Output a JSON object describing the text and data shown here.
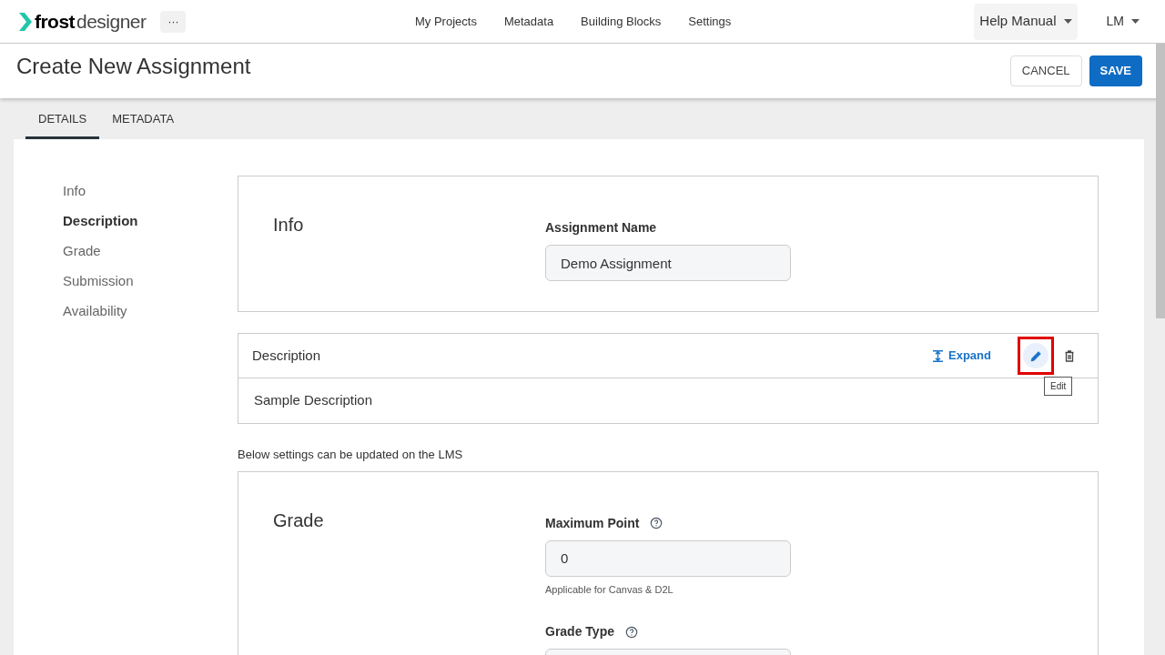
{
  "header": {
    "logo_bold": "frost",
    "logo_light": "designer",
    "more": "···",
    "nav": [
      {
        "label": "My Projects"
      },
      {
        "label": "Metadata"
      },
      {
        "label": "Building Blocks"
      },
      {
        "label": "Settings"
      }
    ],
    "help": "Help Manual",
    "user": "LM"
  },
  "title_bar": {
    "title": "Create New Assignment",
    "cancel": "CANCEL",
    "save": "SAVE"
  },
  "tabs": [
    {
      "label": "DETAILS",
      "selected": true
    },
    {
      "label": "METADATA",
      "selected": false
    }
  ],
  "side_nav": [
    {
      "label": "Info",
      "selected": false
    },
    {
      "label": "Description",
      "selected": true
    },
    {
      "label": "Grade",
      "selected": false
    },
    {
      "label": "Submission",
      "selected": false
    },
    {
      "label": "Availability",
      "selected": false
    }
  ],
  "info": {
    "heading": "Info",
    "field_label": "Assignment Name",
    "value": "Demo Assignment"
  },
  "description": {
    "title": "Description",
    "expand": "Expand",
    "edit_highlighted": true,
    "tooltip": "Edit",
    "body": "Sample Description"
  },
  "note": "Below settings can be updated on the LMS",
  "grade": {
    "heading": "Grade",
    "fields": [
      {
        "label": "Maximum Point",
        "value": "0",
        "hint": "Applicable for Canvas & D2L"
      },
      {
        "label": "Grade Type"
      }
    ]
  }
}
